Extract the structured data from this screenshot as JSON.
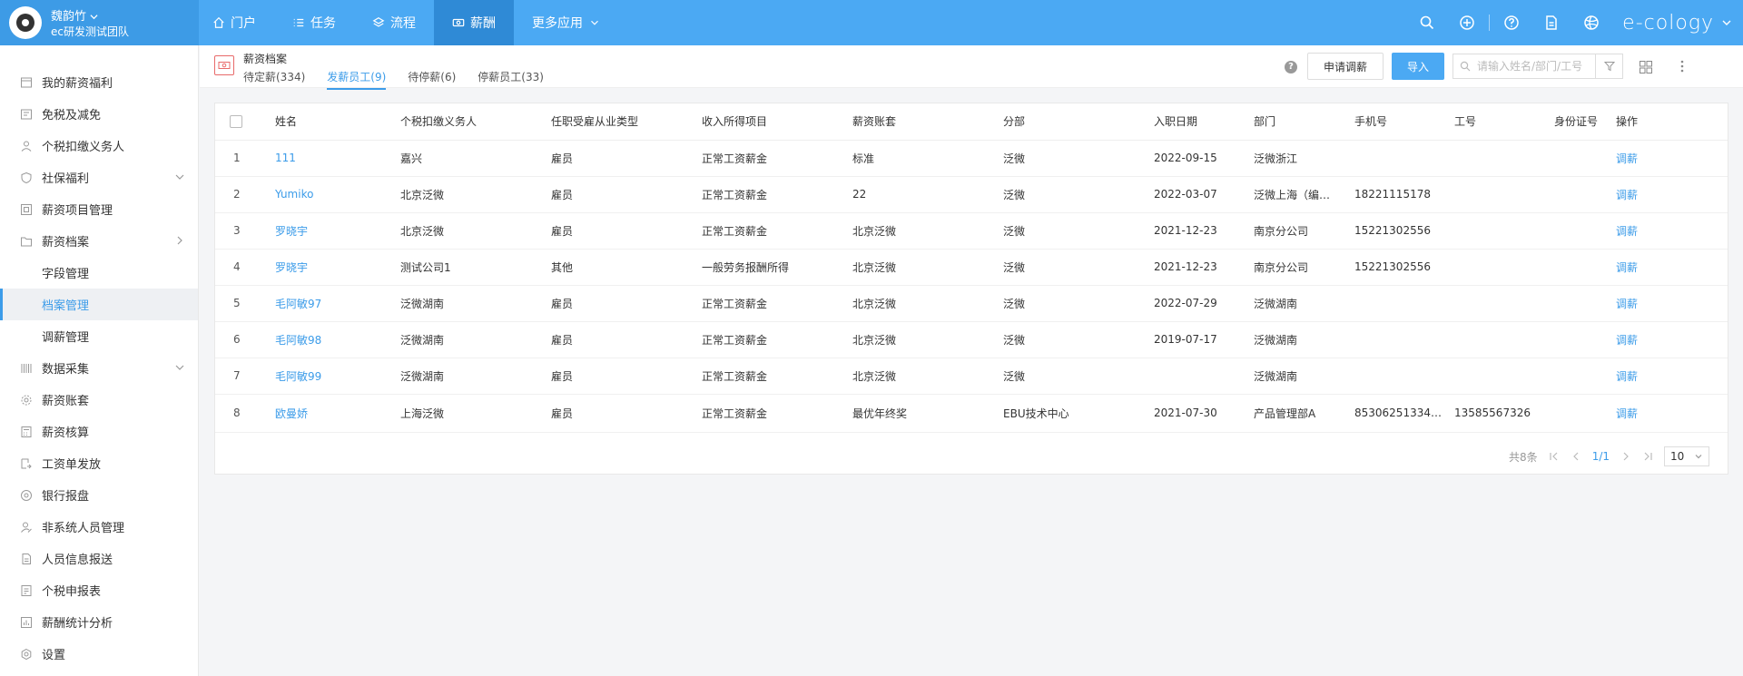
{
  "user": {
    "name": "魏韵竹",
    "team": "ec研发测试团队"
  },
  "nav": [
    {
      "label": "门户",
      "icon": "home-icon"
    },
    {
      "label": "任务",
      "icon": "list-icon"
    },
    {
      "label": "流程",
      "icon": "layers-icon"
    },
    {
      "label": "薪酬",
      "icon": "money-icon",
      "active": true
    },
    {
      "label": "更多应用",
      "icon": "chevron-down-icon"
    }
  ],
  "topbar": {
    "brand": "e-cology"
  },
  "sidebar": {
    "items": [
      {
        "label": "我的薪资福利"
      },
      {
        "label": "免税及减免"
      },
      {
        "label": "个税扣缴义务人"
      },
      {
        "label": "社保福利"
      },
      {
        "label": "薪资项目管理"
      },
      {
        "label": "薪资档案"
      },
      {
        "label": "字段管理"
      },
      {
        "label": "档案管理"
      },
      {
        "label": "调薪管理"
      },
      {
        "label": "数据采集"
      },
      {
        "label": "薪资账套"
      },
      {
        "label": "薪资核算"
      },
      {
        "label": "工资单发放"
      },
      {
        "label": "银行报盘"
      },
      {
        "label": "非系统人员管理"
      },
      {
        "label": "人员信息报送"
      },
      {
        "label": "个税申报表"
      },
      {
        "label": "薪酬统计分析"
      },
      {
        "label": "设置"
      }
    ]
  },
  "page": {
    "title": "薪资档案",
    "tabs": [
      {
        "label": "待定薪(334)"
      },
      {
        "label": "发薪员工(9)"
      },
      {
        "label": "待停薪(6)"
      },
      {
        "label": "停薪员工(33)"
      }
    ],
    "help": "?",
    "apply_button": "申请调薪",
    "import_button": "导入",
    "search_placeholder": "请输入姓名/部门/工号"
  },
  "table": {
    "columns": [
      "姓名",
      "个税扣缴义务人",
      "任职受雇从业类型",
      "收入所得项目",
      "薪资账套",
      "分部",
      "入职日期",
      "部门",
      "手机号",
      "工号",
      "身份证号",
      "操作"
    ],
    "rows": [
      {
        "index": "1",
        "name": "111",
        "withholder": "嘉兴",
        "emp_type": "雇员",
        "income": "正常工资薪金",
        "account": "标准",
        "branch": "泛微",
        "date": "2022-09-15",
        "dept": "泛微浙江",
        "phone": "",
        "emp_no": "",
        "id_no": "",
        "action": "调薪"
      },
      {
        "index": "2",
        "name": "Yumiko",
        "withholder": "北京泛微",
        "emp_type": "雇员",
        "income": "正常工资薪金",
        "account": "22",
        "branch": "泛微",
        "date": "2022-03-07",
        "dept": "泛微上海（编…",
        "phone": "18221115178",
        "emp_no": "",
        "id_no": "",
        "action": "调薪"
      },
      {
        "index": "3",
        "name": "罗晓宇",
        "withholder": "北京泛微",
        "emp_type": "雇员",
        "income": "正常工资薪金",
        "account": "北京泛微",
        "branch": "泛微",
        "date": "2021-12-23",
        "dept": "南京分公司",
        "phone": "15221302556",
        "emp_no": "",
        "id_no": "",
        "action": "调薪"
      },
      {
        "index": "4",
        "name": "罗晓宇",
        "withholder": "测试公司1",
        "emp_type": "其他",
        "income": "一般劳务报酬所得",
        "account": "北京泛微",
        "branch": "泛微",
        "date": "2021-12-23",
        "dept": "南京分公司",
        "phone": "15221302556",
        "emp_no": "",
        "id_no": "",
        "action": "调薪"
      },
      {
        "index": "5",
        "name": "毛阿敏97",
        "withholder": "泛微湖南",
        "emp_type": "雇员",
        "income": "正常工资薪金",
        "account": "北京泛微",
        "branch": "泛微",
        "date": "2022-07-29",
        "dept": "泛微湖南",
        "phone": "",
        "emp_no": "",
        "id_no": "",
        "action": "调薪"
      },
      {
        "index": "6",
        "name": "毛阿敏98",
        "withholder": "泛微湖南",
        "emp_type": "雇员",
        "income": "正常工资薪金",
        "account": "北京泛微",
        "branch": "泛微",
        "date": "2019-07-17",
        "dept": "泛微湖南",
        "phone": "",
        "emp_no": "",
        "id_no": "",
        "action": "调薪"
      },
      {
        "index": "7",
        "name": "毛阿敏99",
        "withholder": "泛微湖南",
        "emp_type": "雇员",
        "income": "正常工资薪金",
        "account": "北京泛微",
        "branch": "泛微",
        "date": "",
        "dept": "泛微湖南",
        "phone": "",
        "emp_no": "",
        "id_no": "",
        "action": "调薪"
      },
      {
        "index": "8",
        "name": "欧曼娇",
        "withholder": "上海泛微",
        "emp_type": "雇员",
        "income": "正常工资薪金",
        "account": "最优年终奖",
        "branch": "EBU技术中心",
        "date": "2021-07-30",
        "dept": "产品管理部A",
        "phone": "85306251334…",
        "emp_no": "13585567326",
        "id_no": "",
        "action": "调薪"
      }
    ]
  },
  "pagination": {
    "total": "共8条",
    "page": "1/1",
    "size": "10"
  },
  "colors": {
    "topbar": "#4ba9f3",
    "active_nav": "#2f8ad6",
    "accent": "#3c9ce9"
  }
}
